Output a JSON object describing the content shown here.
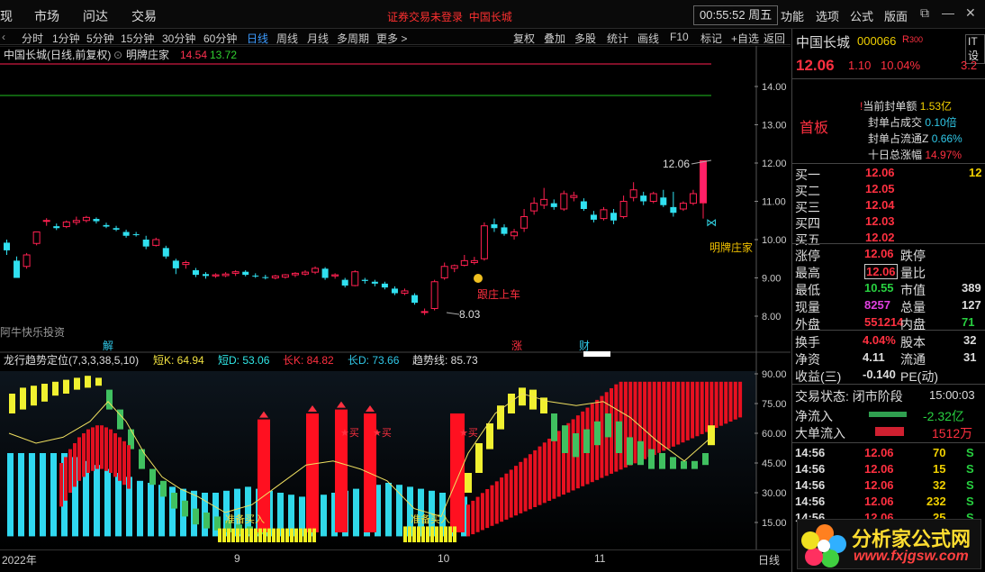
{
  "menubar": {
    "items": [
      "现",
      "市场",
      "问达",
      "交易"
    ],
    "alert": "证券交易未登录",
    "stock": "中国长城",
    "clock": "00:55:52 周五",
    "right_items": [
      "功能",
      "选项",
      "公式",
      "版面"
    ],
    "watermark": "分析家公式网www.fxjgsw.com"
  },
  "toolbar": {
    "periods": [
      "分时",
      "1分钟",
      "5分钟",
      "15分钟",
      "30分钟",
      "60分钟",
      "日线",
      "周线",
      "月线",
      "多周期",
      "更多 >"
    ],
    "active": "日线",
    "tools": [
      "复权",
      "叠加",
      "多股",
      "统计",
      "画线",
      "F10",
      "标记",
      "+自选",
      "返回"
    ]
  },
  "kline": {
    "title": "中国长城(日线,前复权)",
    "indicator_name": "明牌庄家",
    "v1": "14.54",
    "v2": "13.72",
    "y_ticks": [
      "14.00",
      "13.00",
      "12.00",
      "11.00",
      "10.00",
      "9.00",
      "8.00"
    ],
    "high_label": "12.06",
    "low_label": "8.03",
    "label_buy": "跟庄上车",
    "label_dealer": "明牌庄家",
    "sub_label": "阿牛快乐投资",
    "markers": [
      "解",
      "涨",
      "财"
    ]
  },
  "indicator": {
    "name": "龙行趋势定位",
    "params": "(7,3,3,38,5,10)",
    "short_k": "短K: 64.94",
    "short_d": "短D: 53.06",
    "long_k": "长K: 84.82",
    "long_d": "长D: 73.66",
    "trend": "趋势线: 85.73",
    "y_ticks": [
      "90.00",
      "75.00",
      "60.00",
      "45.00",
      "30.00",
      "15.00"
    ],
    "buy_label": "★买",
    "prep_label": "准备买入"
  },
  "datebar": {
    "labels": [
      "2022年",
      "9",
      "10",
      "11"
    ],
    "period": "日线"
  },
  "quote": {
    "name": "中国长城",
    "code": "000066",
    "tag": "R",
    "tag2": "300",
    "it": "IT设",
    "price": "12.06",
    "change": "1.10",
    "pct": "10.04%",
    "extra": "3.2",
    "board": "首板",
    "seal": [
      {
        "k": "当前封单额",
        "v": "1.53亿"
      },
      {
        "k": "封单占成交",
        "v": "0.10倍"
      },
      {
        "k": "封单占流通Z",
        "v": "0.66%"
      },
      {
        "k": "十日总涨幅",
        "v": "14.97%"
      }
    ],
    "asks": [
      {
        "k": "买一",
        "p": "12.06",
        "v": "12"
      },
      {
        "k": "买二",
        "p": "12.05",
        "v": ""
      },
      {
        "k": "买三",
        "p": "12.04",
        "v": ""
      },
      {
        "k": "买四",
        "p": "12.03",
        "v": ""
      },
      {
        "k": "买五",
        "p": "12.02",
        "v": ""
      }
    ],
    "stats": [
      {
        "a": "涨停",
        "av": "12.06",
        "b": "跌停",
        "bv": ""
      },
      {
        "a": "最高",
        "av": "12.06",
        "b": "量比",
        "bv": ""
      },
      {
        "a": "最低",
        "av": "10.55",
        "b": "市值",
        "bv": "389"
      },
      {
        "a": "现量",
        "av": "8257",
        "b": "总量",
        "bv": "127"
      },
      {
        "a": "外盘",
        "av": "551214",
        "b": "内盘",
        "bv": "71"
      }
    ],
    "fund": [
      {
        "a": "换手",
        "av": "4.04%",
        "b": "股本",
        "bv": "32"
      },
      {
        "a": "净资",
        "av": "4.11",
        "b": "流通",
        "bv": "31"
      },
      {
        "a": "收益(三)",
        "av": "-0.140",
        "b": "PE(动)",
        "bv": ""
      }
    ],
    "trade_state": "交易状态: 闭市阶段",
    "trade_time": "15:00:03",
    "net_in": "净流入",
    "net_in_v": "-2.32亿",
    "big_in": "大单流入",
    "big_in_v": "1512万",
    "ticks": [
      {
        "t": "14:56",
        "p": "12.06",
        "v": "70",
        "s": "S"
      },
      {
        "t": "14:56",
        "p": "12.06",
        "v": "15",
        "s": "S"
      },
      {
        "t": "14:56",
        "p": "12.06",
        "v": "32",
        "s": "S"
      },
      {
        "t": "14:56",
        "p": "12.06",
        "v": "232",
        "s": "S"
      },
      {
        "t": "14:56",
        "p": "12.06",
        "v": "25",
        "s": "S"
      }
    ]
  },
  "logo": {
    "text": "分析家公式网",
    "url": "www.fxjgsw.com"
  },
  "chart_data": {
    "type": "candlestick",
    "candles": [
      [
        9.92,
        10.0,
        9.6,
        9.72
      ],
      [
        9.45,
        9.56,
        9.0,
        9.0
      ],
      [
        9.3,
        9.65,
        9.24,
        9.6
      ],
      [
        9.9,
        10.2,
        9.85,
        10.2
      ],
      [
        10.48,
        10.56,
        10.36,
        10.5
      ],
      [
        10.35,
        10.42,
        10.25,
        10.3
      ],
      [
        10.34,
        10.5,
        10.3,
        10.46
      ],
      [
        10.45,
        10.6,
        10.38,
        10.5
      ],
      [
        10.5,
        10.62,
        10.45,
        10.58
      ],
      [
        10.54,
        10.58,
        10.42,
        10.48
      ],
      [
        10.38,
        10.44,
        10.3,
        10.34
      ],
      [
        10.3,
        10.36,
        10.22,
        10.26
      ],
      [
        10.2,
        10.26,
        10.05,
        10.1
      ],
      [
        10.14,
        10.2,
        10.08,
        10.12
      ],
      [
        10.0,
        10.1,
        9.75,
        9.82
      ],
      [
        9.85,
        10.05,
        9.82,
        10.0
      ],
      [
        9.78,
        9.84,
        9.5,
        9.56
      ],
      [
        9.45,
        9.5,
        9.1,
        9.25
      ],
      [
        9.35,
        9.45,
        9.24,
        9.4
      ],
      [
        9.2,
        9.26,
        9.02,
        9.08
      ],
      [
        9.1,
        9.15,
        8.98,
        9.05
      ],
      [
        9.05,
        9.12,
        9.0,
        9.08
      ],
      [
        9.06,
        9.15,
        9.02,
        9.1
      ],
      [
        9.12,
        9.2,
        9.05,
        9.16
      ],
      [
        9.16,
        9.2,
        9.04,
        9.08
      ],
      [
        9.06,
        9.12,
        9.0,
        9.04
      ],
      [
        9.02,
        9.08,
        8.96,
        9.0
      ],
      [
        9.0,
        9.08,
        8.96,
        9.05
      ],
      [
        9.02,
        9.1,
        8.98,
        9.08
      ],
      [
        9.08,
        9.15,
        9.02,
        9.12
      ],
      [
        9.1,
        9.2,
        9.06,
        9.15
      ],
      [
        9.15,
        9.3,
        9.1,
        9.25
      ],
      [
        9.24,
        9.28,
        8.95,
        9.0
      ],
      [
        9.05,
        9.12,
        8.98,
        9.08
      ],
      [
        8.95,
        9.0,
        8.75,
        8.8
      ],
      [
        8.8,
        9.2,
        8.78,
        9.16
      ],
      [
        8.95,
        9.0,
        8.85,
        8.92
      ],
      [
        8.9,
        8.95,
        8.78,
        8.85
      ],
      [
        8.85,
        8.9,
        8.7,
        8.75
      ],
      [
        8.72,
        8.78,
        8.55,
        8.6
      ],
      [
        8.6,
        8.72,
        8.55,
        8.66
      ],
      [
        8.55,
        8.6,
        8.3,
        8.35
      ],
      [
        8.1,
        8.2,
        8.03,
        8.12
      ],
      [
        8.2,
        8.95,
        8.15,
        8.9
      ],
      [
        9.0,
        9.4,
        8.95,
        9.3
      ],
      [
        9.25,
        9.35,
        9.15,
        9.32
      ],
      [
        9.33,
        9.6,
        9.3,
        9.45
      ],
      [
        9.4,
        9.55,
        9.35,
        9.45
      ],
      [
        9.5,
        10.45,
        9.45,
        10.36
      ],
      [
        10.4,
        10.55,
        10.2,
        10.3
      ],
      [
        10.32,
        10.4,
        10.1,
        10.15
      ],
      [
        10.1,
        10.28,
        10.0,
        10.2
      ],
      [
        10.3,
        10.8,
        10.2,
        10.6
      ],
      [
        10.75,
        11.1,
        10.65,
        10.95
      ],
      [
        10.9,
        11.35,
        10.8,
        11.05
      ],
      [
        10.95,
        11.05,
        10.78,
        10.85
      ],
      [
        10.8,
        11.28,
        10.75,
        11.2
      ],
      [
        11.1,
        11.25,
        11.0,
        11.15
      ],
      [
        11.0,
        11.08,
        10.75,
        10.8
      ],
      [
        10.65,
        10.75,
        10.45,
        10.52
      ],
      [
        10.55,
        10.85,
        10.5,
        10.78
      ],
      [
        10.7,
        10.8,
        10.4,
        10.5
      ],
      [
        10.6,
        11.15,
        10.55,
        11.0
      ],
      [
        11.1,
        11.5,
        11.0,
        11.3
      ],
      [
        11.15,
        11.25,
        10.9,
        11.0
      ],
      [
        11.0,
        11.25,
        10.95,
        11.2
      ],
      [
        11.1,
        11.3,
        10.85,
        10.9
      ],
      [
        10.85,
        11.25,
        10.6,
        10.7
      ],
      [
        10.8,
        11.0,
        10.75,
        10.95
      ],
      [
        10.95,
        11.3,
        10.9,
        11.2
      ],
      [
        10.96,
        12.06,
        10.55,
        12.06
      ]
    ]
  }
}
